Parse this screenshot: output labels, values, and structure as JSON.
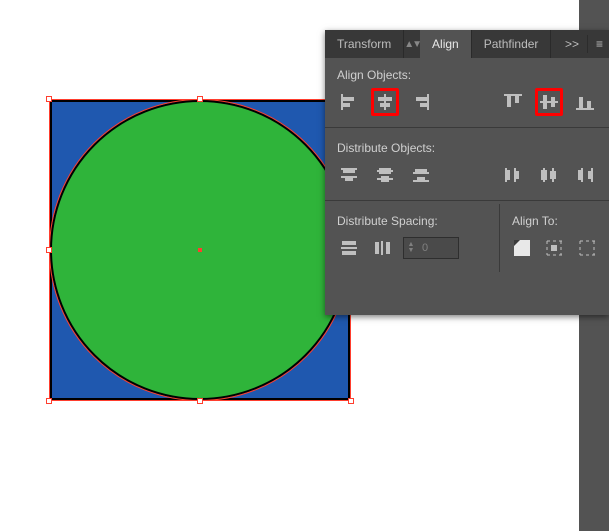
{
  "tabs": {
    "transform": "Transform",
    "align": "Align",
    "pathfinder": "Pathfinder"
  },
  "section": {
    "align_objects": "Align Objects:",
    "distribute_objects": "Distribute Objects:",
    "distribute_spacing": "Distribute Spacing:",
    "align_to": "Align To:"
  },
  "spacing_value": "0",
  "more_glyph": ">>"
}
